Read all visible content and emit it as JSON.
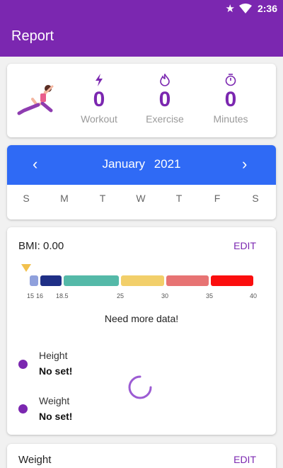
{
  "status_bar": {
    "time": "2:36",
    "icons": [
      "star-icon",
      "wifi-icon"
    ]
  },
  "app_bar": {
    "title": "Report"
  },
  "summary": {
    "workout": {
      "value": "0",
      "label": "Workout",
      "icon": "lightning-icon"
    },
    "exercise": {
      "value": "0",
      "label": "Exercise",
      "icon": "flame-icon"
    },
    "minutes": {
      "value": "0",
      "label": "Minutes",
      "icon": "stopwatch-icon"
    }
  },
  "calendar": {
    "month": "January",
    "year": "2021",
    "days": [
      "S",
      "M",
      "T",
      "W",
      "T",
      "F",
      "S"
    ]
  },
  "bmi": {
    "title": "BMI: 0.00",
    "edit_label": "EDIT",
    "value": 0.0,
    "scale_ticks": [
      "15",
      "16",
      "18.5",
      "25",
      "30",
      "35",
      "40"
    ],
    "scale_colors": [
      "#8fa0dc",
      "#1f2f86",
      "#54b9a8",
      "#f2cf6a",
      "#e77373",
      "#fb0e0e"
    ],
    "message": "Need more data!",
    "height_label": "Height",
    "height_value": "No set!",
    "weight_label": "Weight",
    "weight_value": "No set!"
  },
  "weight_card": {
    "title": "Weight",
    "edit_label": "EDIT"
  },
  "colors": {
    "primary": "#7b27b0",
    "calendar": "#2f6af5"
  }
}
